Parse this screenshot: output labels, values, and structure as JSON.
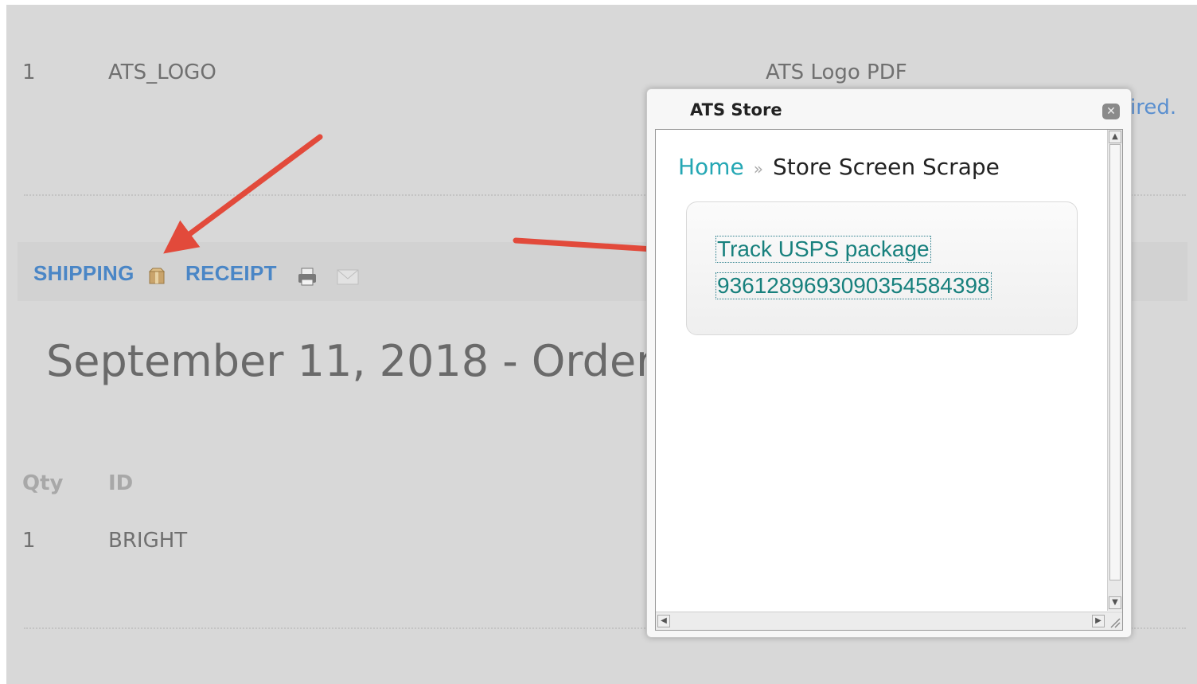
{
  "background_rows": [
    {
      "qty": "1",
      "id": "ATS_LOGO",
      "description": "ATS Logo PDF"
    },
    {
      "qty": "1",
      "id": "BRIGHT"
    }
  ],
  "partial_right_text": "ired.",
  "toolbar": {
    "shipping_label": "SHIPPING",
    "receipt_label": "RECEIPT"
  },
  "order_title": "September 11, 2018 - Order #",
  "table_headers": {
    "qty": "Qty",
    "id": "ID"
  },
  "modal": {
    "title": "ATS Store",
    "breadcrumb": {
      "home": "Home",
      "separator": "»",
      "current": "Store Screen Scrape"
    },
    "track_link_text": "Track USPS package",
    "tracking_number": "9361289693090354584398"
  },
  "annotation_color": "#e24a3b",
  "accent_color": "#24a7b4",
  "link_color": "#4a86c6",
  "icons": [
    "package-icon",
    "print-icon",
    "email-icon",
    "close-icon",
    "scroll-up-icon",
    "scroll-down-icon",
    "scroll-left-icon",
    "scroll-right-icon",
    "resize-grip-icon"
  ]
}
